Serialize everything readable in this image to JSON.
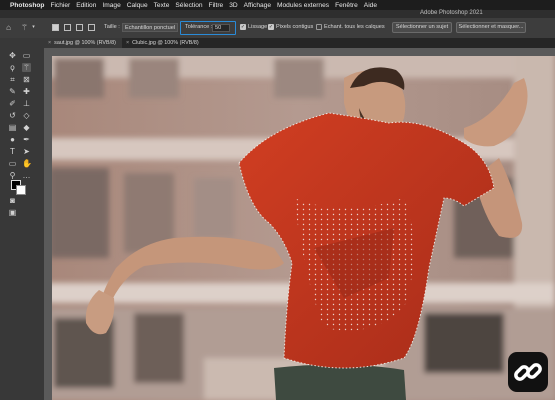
{
  "menubar": {
    "items": [
      "Photoshop",
      "Fichier",
      "Edition",
      "Image",
      "Calque",
      "Texte",
      "Sélection",
      "Filtre",
      "3D",
      "Affichage",
      "Modules externes",
      "Fenêtre",
      "Aide"
    ]
  },
  "window": {
    "title": "Adobe Photoshop 2021"
  },
  "options_bar": {
    "taille_label": "Taille :",
    "taille_value": "Echantillon ponctuel",
    "tolerance_label": "Tolérance :",
    "tolerance_value": "50",
    "lissage_label": "Lissage",
    "lissage_checked": true,
    "pixels_contigus_label": "Pixels contigus",
    "pixels_contigus_checked": true,
    "echant_label": "Echant. tous les calques",
    "echant_checked": false,
    "select_subject_label": "Sélectionner un sujet",
    "select_mask_label": "Sélectionner et masquer..."
  },
  "tabs": [
    {
      "label": "saut.jpg @ 100% (RVB/8)",
      "active": true
    },
    {
      "label": "Clubic.jpg @ 100% (RVB/8)",
      "active": false
    }
  ],
  "icons": {
    "home": "home-icon",
    "magic_wand": "magic-wand-icon"
  },
  "colors": {
    "accent": "#2a8bd8",
    "shirt": "#c0361f",
    "panel": "#3d3d3d"
  }
}
